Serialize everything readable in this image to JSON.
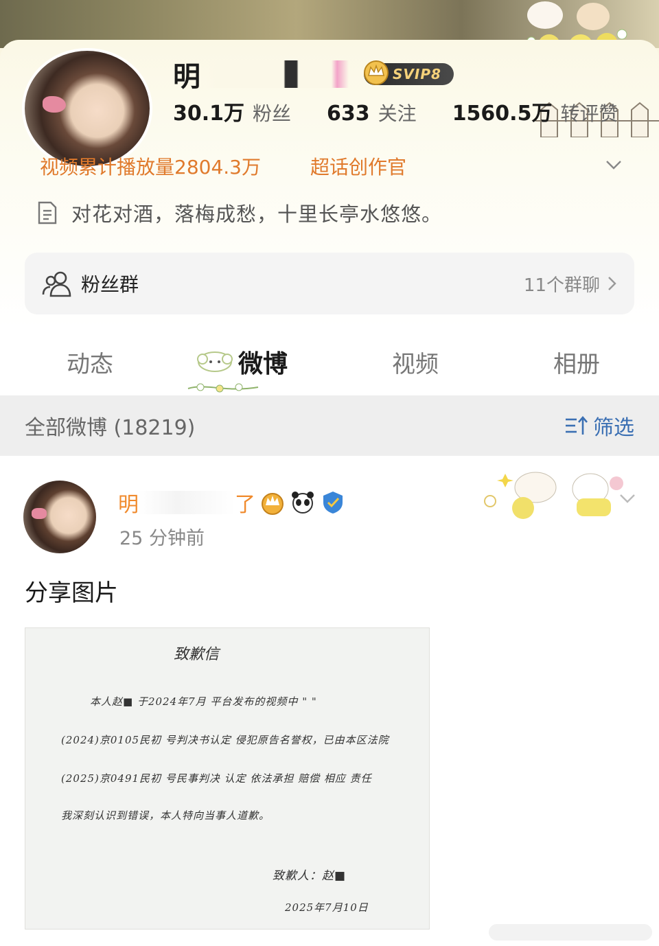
{
  "profile": {
    "name_visible": "明",
    "vip_label": "SVIP8",
    "stats": [
      {
        "num": "30.1万",
        "label": "粉丝"
      },
      {
        "num": "633",
        "label": "关注"
      },
      {
        "num": "1560.5万",
        "label": "转评赞"
      }
    ],
    "tags": [
      "视频累计播放量2804.3万",
      "超话创作官"
    ],
    "bio": "对花对酒，落梅成愁，十里长亭水悠悠。",
    "fan_group": {
      "label": "粉丝群",
      "count": "11个群聊"
    }
  },
  "tabs": [
    {
      "label": "动态",
      "active": false
    },
    {
      "label": "微博",
      "active": true
    },
    {
      "label": "视频",
      "active": false
    },
    {
      "label": "相册",
      "active": false
    }
  ],
  "feed": {
    "title": "全部微博 (18219)",
    "filter_label": "筛选"
  },
  "post": {
    "author_start": "明",
    "author_end": "了",
    "time": "25 分钟前",
    "text": "分享图片",
    "letter": {
      "title": "致歉信",
      "lines": [
        "本人赵■ 于2024年7月 平台发布的视频中 \"        \"",
        "(2024)京0105民初 号判决书认定 侵犯原告名誉权，已由本区法院",
        "(2025)京0491民初  号民事判决 认定 依法承担 赔偿 相应 责任",
        "我深刻认识到错误，本人特向当事人道歉。"
      ],
      "signature": "致歉人：赵■",
      "date": "2025年7月10日"
    }
  },
  "colors": {
    "accent_orange": "#e07a2c",
    "link_blue": "#3a6fb3",
    "feed_bar_bg": "#eeeeee"
  }
}
